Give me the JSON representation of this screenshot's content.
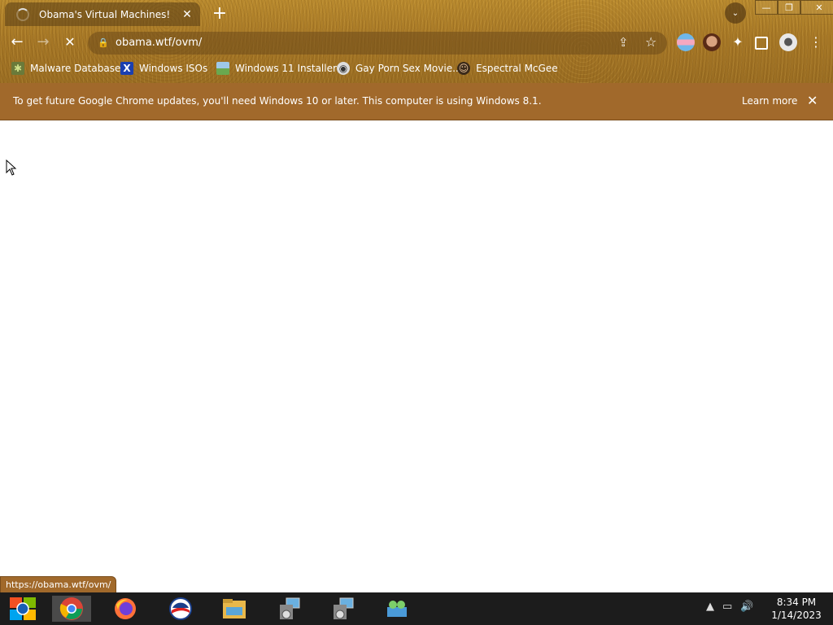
{
  "browser": {
    "tab": {
      "title": "Obama's Virtual Machines!"
    },
    "newtab_label": "+",
    "window_controls": {
      "minimize": "—",
      "restore": "❐",
      "close": "✕"
    },
    "toolbar": {
      "back": "←",
      "forward": "→",
      "reload": "✕",
      "url": "obama.wtf/ovm/"
    },
    "bookmarks": [
      {
        "label": "Malware Database",
        "icon": "bug-icon"
      },
      {
        "label": "Windows ISOs",
        "icon": "x-logo-icon"
      },
      {
        "label": "Windows 11 Installer",
        "icon": "image-icon"
      },
      {
        "label": "Gay Porn Sex Movie...",
        "icon": "disc-icon"
      },
      {
        "label": "Espectral McGee",
        "icon": "face-icon"
      }
    ],
    "infobar": {
      "message": "To get future Google Chrome updates, you'll need Windows 10 or later. This computer is using Windows 8.1.",
      "learn_more": "Learn more"
    },
    "status_url": "https://obama.wtf/ovm/"
  },
  "taskbar": {
    "clock_time": "8:34 PM",
    "clock_date": "1/14/2023"
  },
  "colors": {
    "infobar": "#a1692b",
    "taskbar": "#1c1c1c"
  }
}
